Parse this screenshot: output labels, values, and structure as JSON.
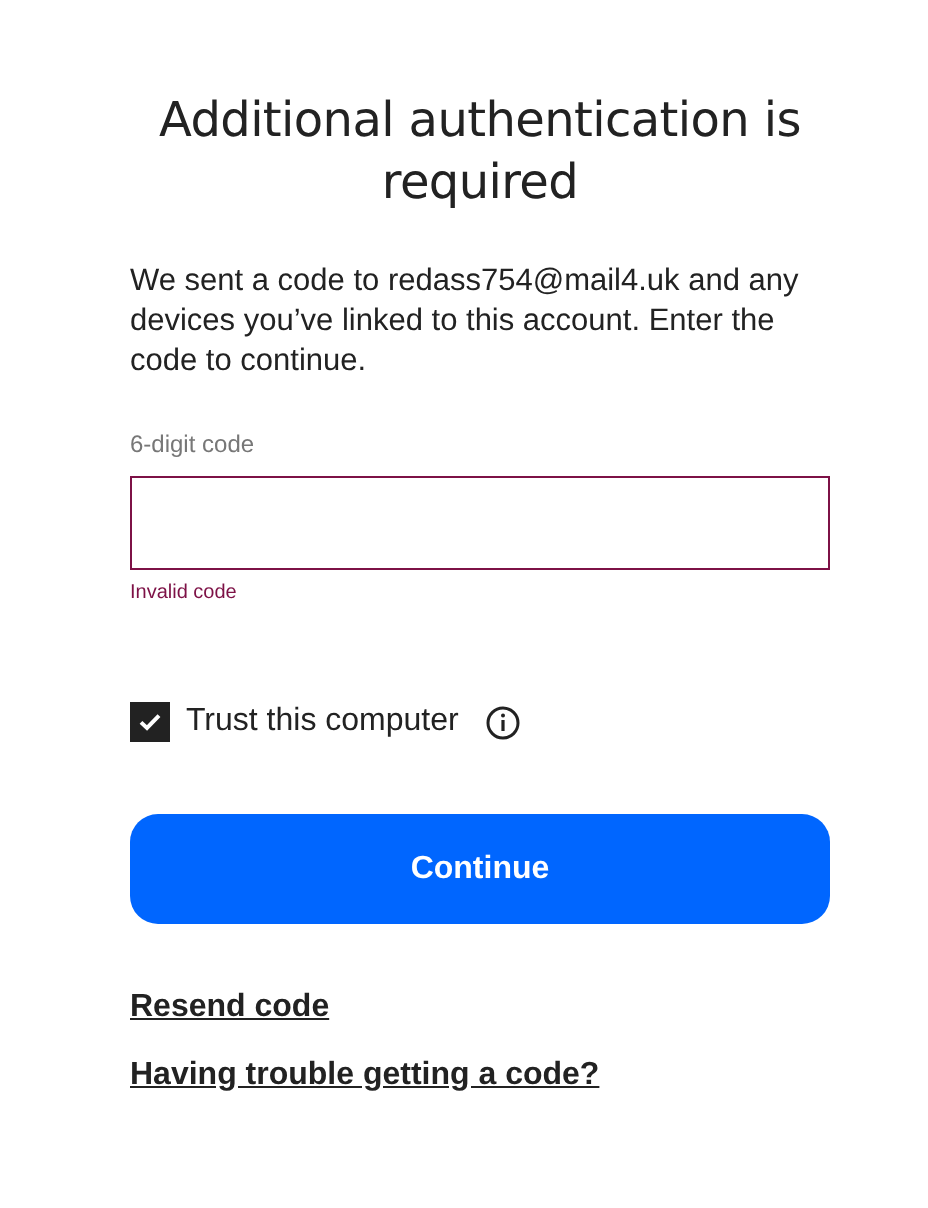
{
  "title": "Additional authentication is required",
  "description": "We sent a code to redass754@mail4.uk and any devices you’ve linked to this account. Enter the code to continue.",
  "code_field": {
    "label": "6-digit code",
    "error": "Invalid code"
  },
  "trust_checkbox": {
    "label": "Trust this computer",
    "checked": true
  },
  "continue_button": "Continue",
  "links": [
    "Resend code",
    "Having trouble getting a code?"
  ]
}
